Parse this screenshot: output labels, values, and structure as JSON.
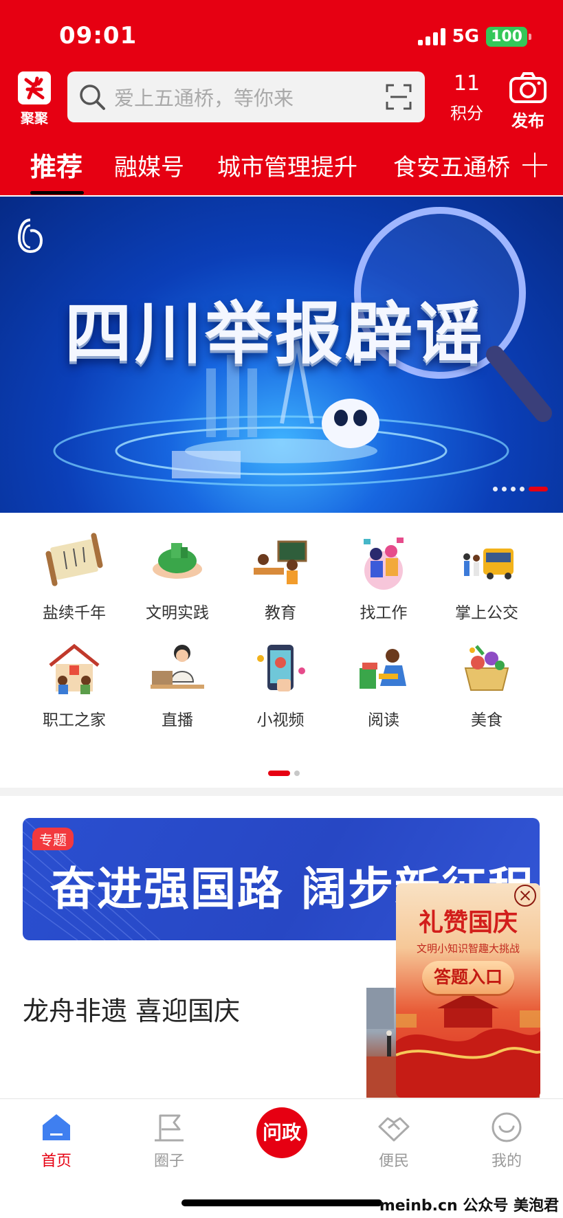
{
  "status_bar": {
    "time": "09:01",
    "network": "5G",
    "battery": "100"
  },
  "header": {
    "logo_label": "聚聚",
    "search_placeholder": "爱上五通桥，等你来",
    "points_value": "11",
    "points_label": "积分",
    "publish_label": "发布"
  },
  "tabs": [
    {
      "label": "推荐",
      "active": true
    },
    {
      "label": "融媒号"
    },
    {
      "label": "城市管理提升"
    },
    {
      "label": "食安五通桥"
    }
  ],
  "banner": {
    "title": "四川举报辟谣",
    "slide_count": 5,
    "active_slide": 5
  },
  "grid": [
    {
      "label": "盐续千年",
      "icon": "scroll-icon"
    },
    {
      "label": "文明实践",
      "icon": "green-hands-icon"
    },
    {
      "label": "教育",
      "icon": "classroom-icon"
    },
    {
      "label": "找工作",
      "icon": "job-icon"
    },
    {
      "label": "掌上公交",
      "icon": "bus-icon"
    },
    {
      "label": "职工之家",
      "icon": "workers-home-icon"
    },
    {
      "label": "直播",
      "icon": "livestream-icon"
    },
    {
      "label": "小视频",
      "icon": "video-phone-icon"
    },
    {
      "label": "阅读",
      "icon": "reading-icon"
    },
    {
      "label": "美食",
      "icon": "food-basket-icon"
    }
  ],
  "feature": {
    "tag": "专题",
    "title": "奋进强国路 阔步新征程"
  },
  "popup": {
    "title": "礼赞国庆",
    "subtitle": "文明小知识智趣大挑战",
    "button": "答题入口"
  },
  "article": {
    "title": "龙舟非遗 喜迎国庆"
  },
  "bottom_nav": [
    {
      "label": "首页",
      "active": true,
      "icon": "home-icon"
    },
    {
      "label": "圈子",
      "icon": "flag-icon"
    },
    {
      "label": "问政",
      "icon": "center-icon"
    },
    {
      "label": "便民",
      "icon": "handshake-icon"
    },
    {
      "label": "我的",
      "icon": "smile-icon"
    }
  ],
  "watermark": "meinb.cn 公众号 美泡君",
  "colors": {
    "brand_red": "#e60012",
    "battery_green": "#34c759"
  }
}
